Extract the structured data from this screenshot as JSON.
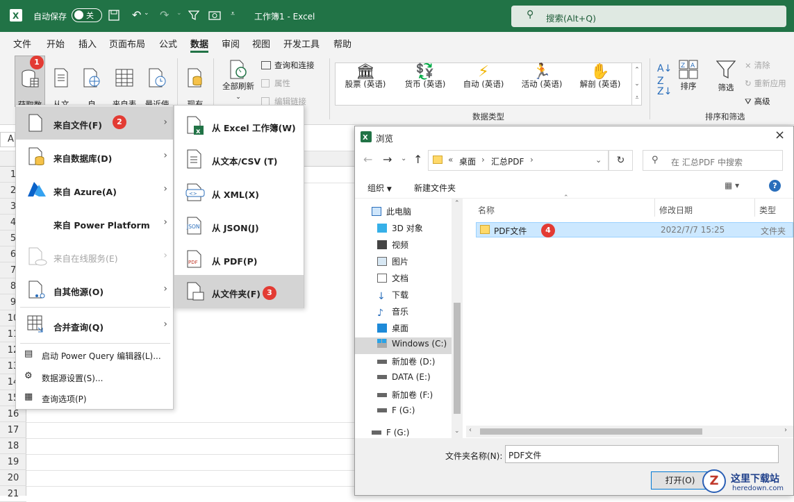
{
  "titlebar": {
    "autosave_label": "自动保存",
    "autosave_state": "关",
    "doc_title": "工作簿1  -  Excel",
    "search_placeholder": "搜索(Alt+Q)"
  },
  "menu_tabs": [
    "文件",
    "开始",
    "插入",
    "页面布局",
    "公式",
    "数据",
    "审阅",
    "视图",
    "开发工具",
    "帮助"
  ],
  "active_tab": "数据",
  "ribbon": {
    "get_data": "获取数\n据",
    "from_text_csv": "从文\n本/CSV",
    "from_web": "自\n网站",
    "from_table": "来自表\n格/区域",
    "recent_sources": "最近使\n用的源",
    "existing_conn": "现有\n连接",
    "refresh_all": "全部刷新",
    "queries_conn": "查询和连接",
    "properties": "属性",
    "edit_links": "编辑链接",
    "datatypes": [
      "股票 (英语)",
      "货币 (英语)",
      "自动 (英语)",
      "活动 (英语)",
      "解剖 (英语)"
    ],
    "datatypes_group": "数据类型",
    "sort": "排序",
    "filter": "筛选",
    "clear": "清除",
    "reapply": "重新应用",
    "advanced": "高级",
    "sortfilter_group": "排序和筛选"
  },
  "rows": [
    "1",
    "2",
    "3",
    "4",
    "5",
    "6",
    "7",
    "8",
    "9",
    "10",
    "11",
    "12",
    "13",
    "14",
    "15",
    "16",
    "17",
    "18",
    "19",
    "20",
    "21"
  ],
  "menu1": {
    "items": [
      {
        "label": "来自文件(F)",
        "icon": "file-icon"
      },
      {
        "label": "来自数据库(D)",
        "icon": "database-icon"
      },
      {
        "label": "来自 Azure(A)",
        "icon": "azure-icon"
      },
      {
        "label": "来自 Power Platform",
        "icon": ""
      },
      {
        "label": "来自在线服务(E)",
        "icon": "cloud-file-icon"
      },
      {
        "label": "自其他源(O)",
        "icon": "other-sources-icon"
      },
      {
        "label": "合并查询(Q)",
        "icon": "combine-icon"
      }
    ],
    "bottom": [
      "启动 Power Query 编辑器(L)...",
      "数据源设置(S)...",
      "查询选项(P)"
    ]
  },
  "menu2": {
    "items": [
      "从 Excel 工作簿(W)",
      "从文本/CSV (T)",
      "从 XML(X)",
      "从 JSON(J)",
      "从 PDF(P)",
      "从文件夹(F)"
    ]
  },
  "badges": [
    "1",
    "2",
    "3",
    "4"
  ],
  "dialog": {
    "title": "浏览",
    "path": [
      "«",
      "桌面",
      "›",
      "汇总PDF",
      "›"
    ],
    "search_placeholder": "在 汇总PDF 中搜索",
    "organize": "组织",
    "new_folder": "新建文件夹",
    "nav": [
      "此电脑",
      "3D 对象",
      "视频",
      "图片",
      "文档",
      "下载",
      "音乐",
      "桌面",
      "Windows (C:)",
      "新加卷 (D:)",
      "DATA (E:)",
      "新加卷 (F:)",
      "F (G:)",
      "F (G:)"
    ],
    "columns": [
      "名称",
      "修改日期",
      "类型"
    ],
    "files": [
      {
        "name": "PDF文件",
        "date": "2022/7/7 15:25",
        "type": "文件夹"
      }
    ],
    "folder_name_label": "文件夹名称(N):",
    "folder_name_value": "PDF文件",
    "open_button": "打开(O)"
  },
  "watermark": {
    "site": "这里下载站",
    "url": "heredown.com"
  },
  "colors": {
    "excel_green": "#217346",
    "badge_red": "#e33b33",
    "select_blue": "#cce8ff"
  }
}
